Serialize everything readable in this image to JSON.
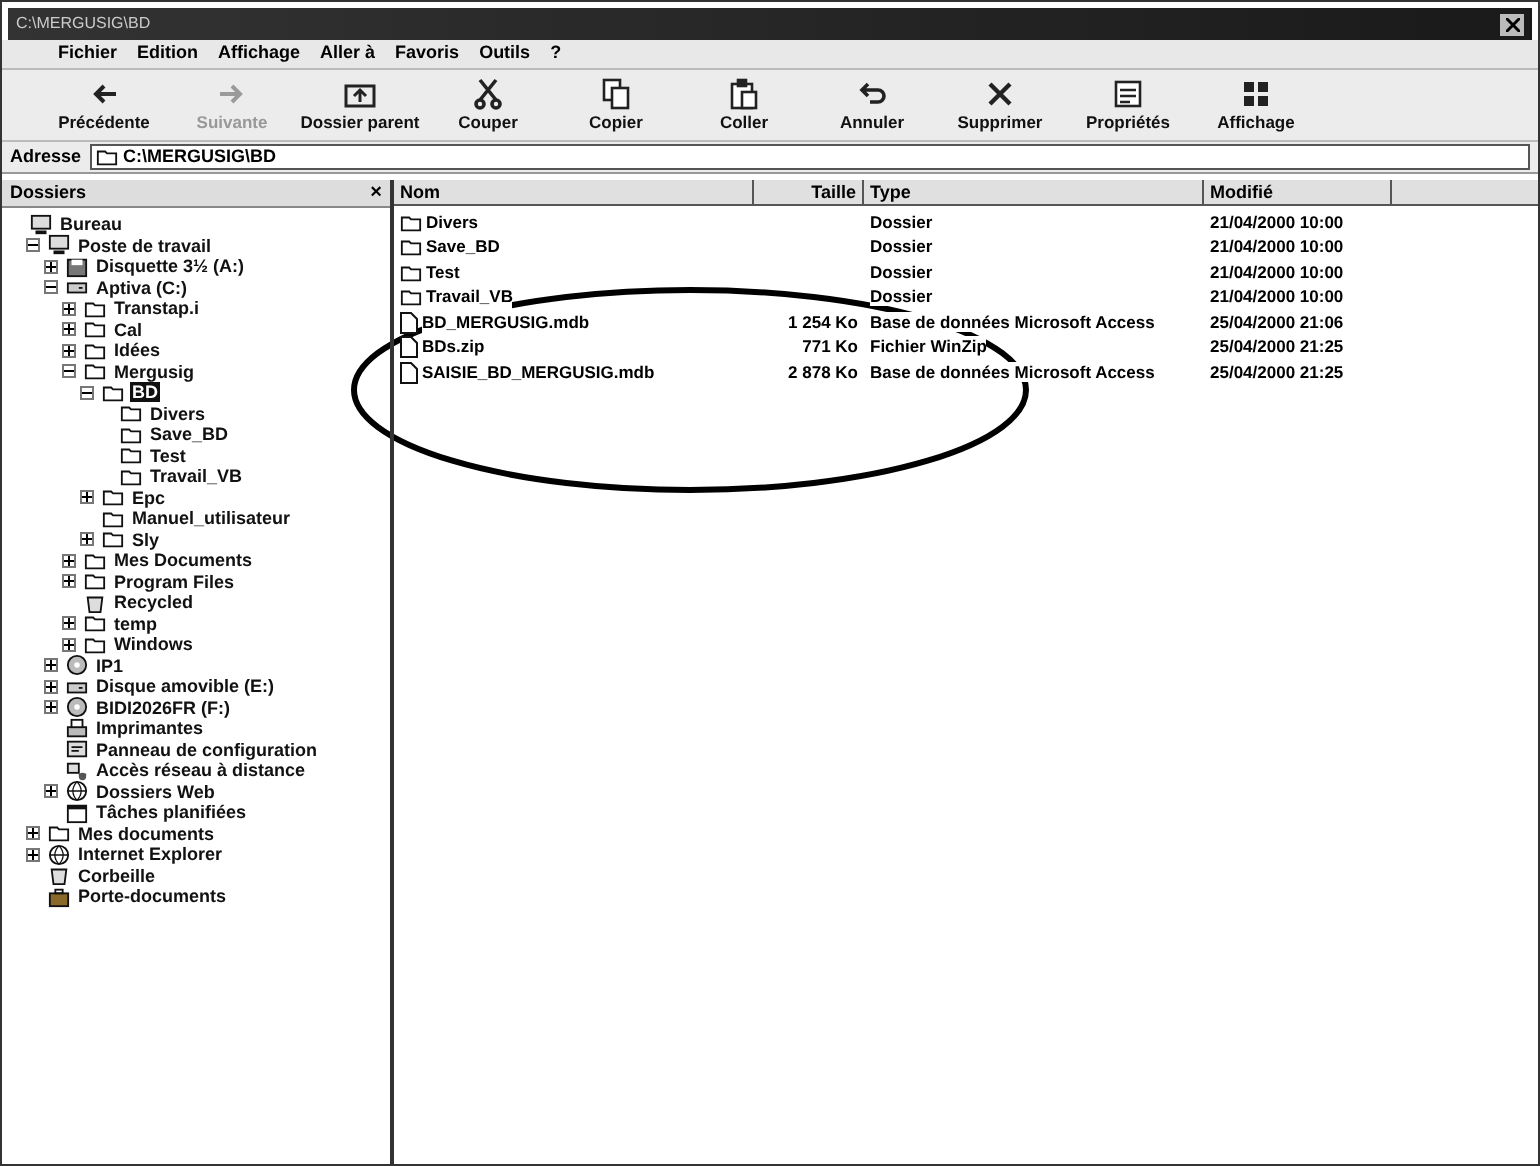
{
  "window": {
    "title": "C:\\MERGUSIG\\BD"
  },
  "menu": [
    "Fichier",
    "Edition",
    "Affichage",
    "Aller à",
    "Favoris",
    "Outils",
    "?"
  ],
  "toolbar": [
    {
      "label": "Précédente",
      "kind": "back",
      "disabled": false
    },
    {
      "label": "Suivante",
      "kind": "forward",
      "disabled": true
    },
    {
      "label": "Dossier parent",
      "kind": "up",
      "disabled": false
    },
    {
      "label": "Couper",
      "kind": "cut",
      "disabled": false
    },
    {
      "label": "Copier",
      "kind": "copy",
      "disabled": false
    },
    {
      "label": "Coller",
      "kind": "paste",
      "disabled": false
    },
    {
      "label": "Annuler",
      "kind": "undo",
      "disabled": false
    },
    {
      "label": "Supprimer",
      "kind": "delete",
      "disabled": false
    },
    {
      "label": "Propriétés",
      "kind": "properties",
      "disabled": false
    },
    {
      "label": "Affichage",
      "kind": "views",
      "disabled": false
    }
  ],
  "address": {
    "label": "Adresse",
    "value": "C:\\MERGUSIG\\BD"
  },
  "folders_pane": {
    "title": "Dossiers",
    "close": "×"
  },
  "tree": [
    {
      "label": "Bureau",
      "kind": "desktop",
      "selected": false,
      "children": [
        {
          "label": "Poste de travail",
          "kind": "computer",
          "expanded": true,
          "selected": false,
          "children": [
            {
              "label": "Disquette 3½ (A:)",
              "kind": "floppy",
              "expanded": false,
              "selected": false
            },
            {
              "label": "Aptiva (C:)",
              "kind": "drive",
              "expanded": true,
              "selected": false,
              "children": [
                {
                  "label": "Transtap.i",
                  "kind": "folder",
                  "expanded": false,
                  "selected": false
                },
                {
                  "label": "Cal",
                  "kind": "folder",
                  "expanded": false,
                  "selected": false
                },
                {
                  "label": "Idées",
                  "kind": "folder",
                  "expanded": false,
                  "selected": false
                },
                {
                  "label": "Mergusig",
                  "kind": "folder",
                  "expanded": true,
                  "selected": false,
                  "children": [
                    {
                      "label": "BD",
                      "kind": "folder",
                      "expanded": true,
                      "selected": true,
                      "children": [
                        {
                          "label": "Divers",
                          "kind": "folder",
                          "selected": false
                        },
                        {
                          "label": "Save_BD",
                          "kind": "folder",
                          "selected": false
                        },
                        {
                          "label": "Test",
                          "kind": "folder",
                          "selected": false
                        },
                        {
                          "label": "Travail_VB",
                          "kind": "folder",
                          "selected": false
                        }
                      ]
                    },
                    {
                      "label": "Epc",
                      "kind": "folder",
                      "expanded": false,
                      "selected": false
                    },
                    {
                      "label": "Manuel_utilisateur",
                      "kind": "folder",
                      "selected": false
                    },
                    {
                      "label": "Sly",
                      "kind": "folder",
                      "expanded": false,
                      "selected": false
                    }
                  ]
                },
                {
                  "label": "Mes Documents",
                  "kind": "folder",
                  "expanded": false,
                  "selected": false
                },
                {
                  "label": "Program Files",
                  "kind": "folder",
                  "expanded": false,
                  "selected": false
                },
                {
                  "label": "Recycled",
                  "kind": "recycle",
                  "selected": false
                },
                {
                  "label": "temp",
                  "kind": "folder",
                  "expanded": false,
                  "selected": false
                },
                {
                  "label": "Windows",
                  "kind": "folder",
                  "expanded": false,
                  "selected": false
                }
              ]
            },
            {
              "label": "IP1",
              "kind": "cdrom",
              "expanded": false,
              "selected": false
            },
            {
              "label": "Disque amovible (E:)",
              "kind": "drive",
              "expanded": false,
              "selected": false
            },
            {
              "label": "BIDI2026FR (F:)",
              "kind": "cdrom",
              "expanded": false,
              "selected": false
            },
            {
              "label": "Imprimantes",
              "kind": "printer",
              "selected": false
            },
            {
              "label": "Panneau de configuration",
              "kind": "control",
              "selected": false
            },
            {
              "label": "Accès réseau à distance",
              "kind": "network",
              "selected": false
            },
            {
              "label": "Dossiers Web",
              "kind": "web",
              "expanded": false,
              "selected": false
            },
            {
              "label": "Tâches planifiées",
              "kind": "tasks",
              "selected": false
            }
          ]
        },
        {
          "label": "Mes documents",
          "kind": "folder",
          "expanded": false,
          "selected": false
        },
        {
          "label": "Internet Explorer",
          "kind": "web",
          "expanded": false,
          "selected": false
        },
        {
          "label": "Corbeille",
          "kind": "recycle",
          "selected": false
        },
        {
          "label": "Porte-documents",
          "kind": "briefcase",
          "selected": false
        }
      ]
    }
  ],
  "table": {
    "columns": [
      "Nom",
      "Taille",
      "Type",
      "Modifié"
    ],
    "rows": [
      {
        "kind": "folder",
        "name": "Divers",
        "size": "",
        "type": "Dossier",
        "modified": "21/04/2000 10:00"
      },
      {
        "kind": "folder",
        "name": "Save_BD",
        "size": "",
        "type": "Dossier",
        "modified": "21/04/2000 10:00"
      },
      {
        "kind": "folder",
        "name": "Test",
        "size": "",
        "type": "Dossier",
        "modified": "21/04/2000 10:00"
      },
      {
        "kind": "folder",
        "name": "Travail_VB",
        "size": "",
        "type": "Dossier",
        "modified": "21/04/2000 10:00"
      },
      {
        "kind": "file",
        "name": "BD_MERGUSIG.mdb",
        "size": "1 254 Ko",
        "type": "Base de données Microsoft Access",
        "modified": "25/04/2000 21:06"
      },
      {
        "kind": "file",
        "name": "BDs.zip",
        "size": "771 Ko",
        "type": "Fichier WinZip",
        "modified": "25/04/2000 21:25"
      },
      {
        "kind": "file",
        "name": "SAISIE_BD_MERGUSIG.mdb",
        "size": "2 878 Ko",
        "type": "Base de données Microsoft Access",
        "modified": "25/04/2000 21:25"
      }
    ]
  }
}
